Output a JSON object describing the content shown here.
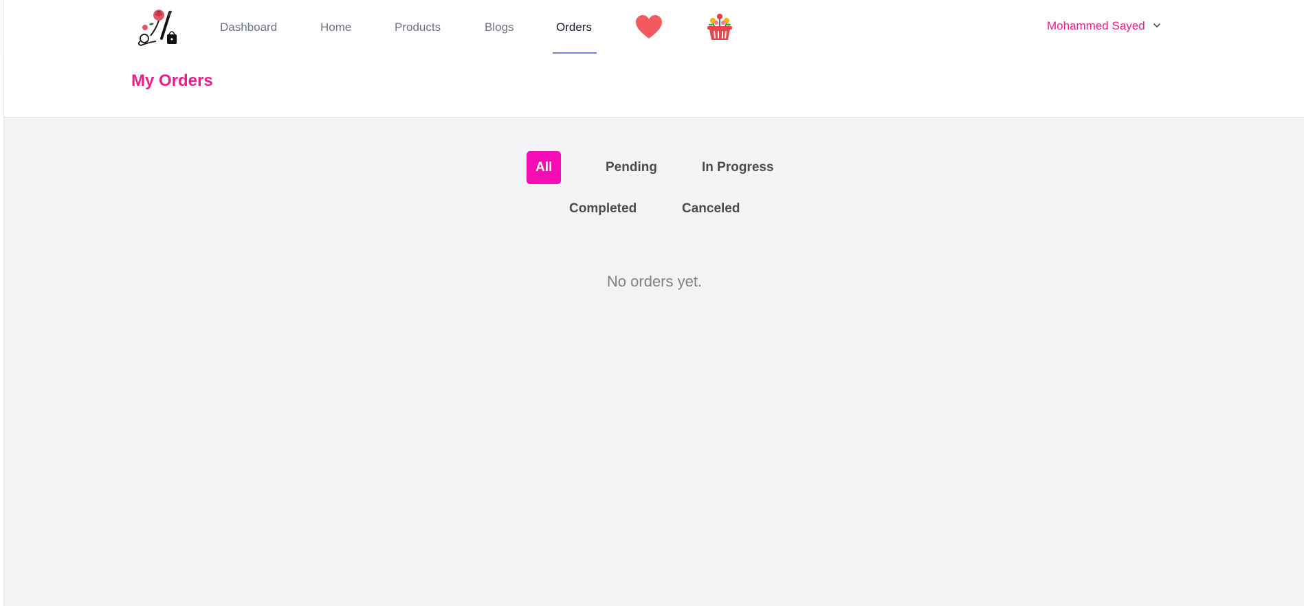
{
  "nav": {
    "logo_icon": "rose-cosmetics-logo-icon",
    "links": [
      {
        "label": "Dashboard"
      },
      {
        "label": "Home"
      },
      {
        "label": "Products"
      },
      {
        "label": "Blogs"
      },
      {
        "label": "Orders",
        "active": true
      }
    ],
    "wishlist_icon": "heart-icon",
    "cart_icon": "flower-basket-icon",
    "user_name": "Mohammed Sayed"
  },
  "header": {
    "title": "My Orders"
  },
  "filters": [
    {
      "label": "All",
      "active": true
    },
    {
      "label": "Pending"
    },
    {
      "label": "In Progress"
    },
    {
      "label": "Completed"
    },
    {
      "label": "Canceled"
    }
  ],
  "empty_message": "No orders yet.",
  "colors": {
    "brand_pink": "#ec1c8a",
    "active_filter": "#f50cb2",
    "nav_underline": "#7b7fe0",
    "heart": "#f25a5f"
  }
}
